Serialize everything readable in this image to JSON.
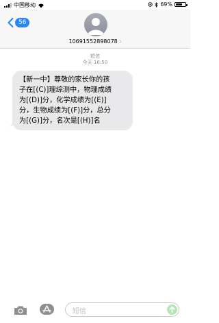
{
  "status_bar": {
    "carrier": "中国移动",
    "battery": "69%",
    "battery_level": 0.69
  },
  "header": {
    "back_count": "56",
    "contact_number": "10691552898078",
    "chevron": "›"
  },
  "conversation": {
    "service": "短信",
    "timestamp": "今天 16:50",
    "message": "【新一中】尊敬的家长你的孩\n子在[(C)]理综测中，物理成绩\n为[(D)]分，化学成绩为[(E)]\n分，生物成绩为[(F)]分，总分\n为[(G)]分，名次是[(H)]名"
  },
  "composer": {
    "placeholder": "短信"
  },
  "icons": {
    "wifi": "wifi-icon",
    "signal": "signal-icon",
    "location": "location-icon",
    "bluetooth": "bluetooth-icon",
    "battery": "battery-icon",
    "back": "chevron-left-icon",
    "avatar": "person-icon",
    "camera": "camera-icon",
    "apps": "app-store-icon",
    "send": "arrow-up-icon"
  },
  "colors": {
    "accent": "#2a86f6",
    "bubble": "#e9e9eb",
    "send": "#b5e6b8"
  }
}
